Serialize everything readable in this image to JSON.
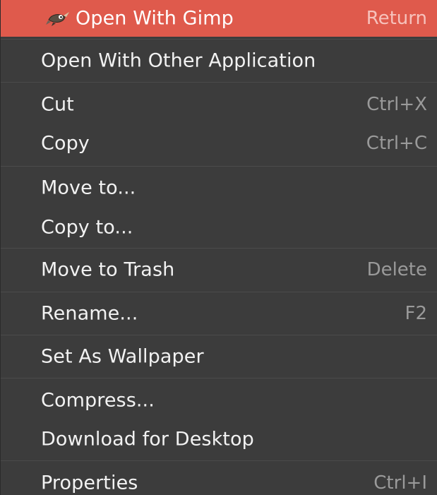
{
  "menu": {
    "items": [
      {
        "label": "Open With Gimp",
        "accel": "Return",
        "icon": "gimp-app-icon",
        "highlighted": true
      },
      {
        "label": "Open With Other Application",
        "accel": ""
      },
      {
        "label": "Cut",
        "accel": "Ctrl+X"
      },
      {
        "label": "Copy",
        "accel": "Ctrl+C"
      },
      {
        "label": "Move to...",
        "accel": ""
      },
      {
        "label": "Copy to...",
        "accel": ""
      },
      {
        "label": "Move to Trash",
        "accel": "Delete"
      },
      {
        "label": "Rename...",
        "accel": "F2"
      },
      {
        "label": "Set As Wallpaper",
        "accel": ""
      },
      {
        "label": "Compress...",
        "accel": ""
      },
      {
        "label": "Download for Desktop",
        "accel": ""
      },
      {
        "label": "Properties",
        "accel": "Ctrl+I"
      }
    ]
  },
  "colors": {
    "menu_background": "#3c3c3c",
    "highlight": "#df5a4c",
    "text": "#f2f2f2",
    "accelerator_text": "#9a9a9a",
    "separator": "#4b4b4b"
  }
}
